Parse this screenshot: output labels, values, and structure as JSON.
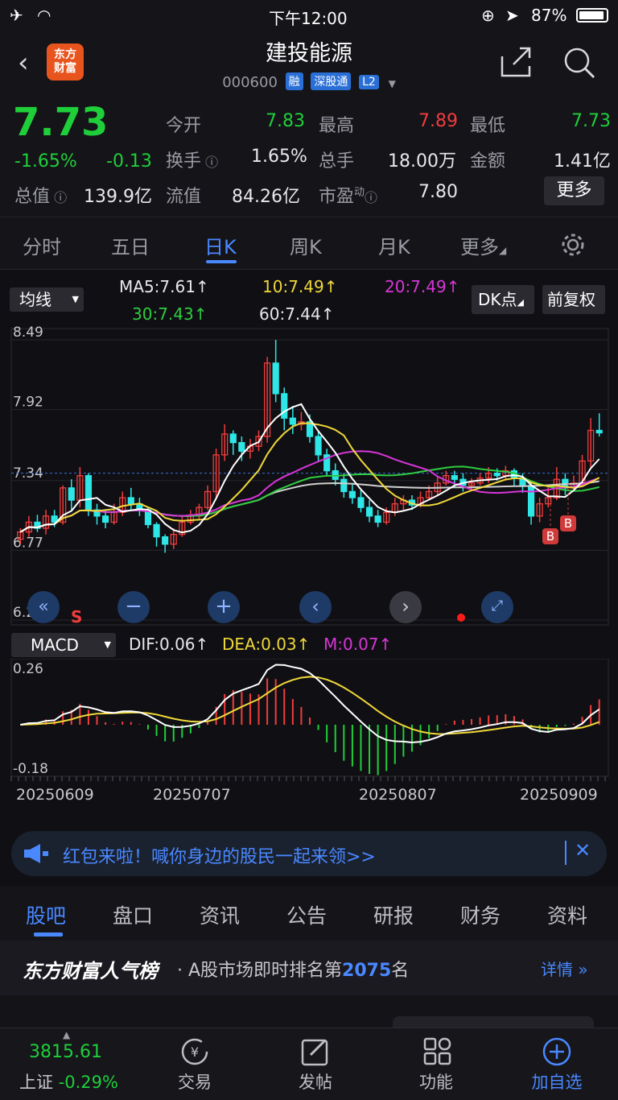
{
  "status": {
    "time": "下午12:00",
    "battery": "87%"
  },
  "nav": {
    "logo_line1": "东方",
    "logo_line2": "财富",
    "title": "建投能源",
    "code": "000600",
    "tags": [
      "融",
      "深股通",
      "L2"
    ]
  },
  "quote": {
    "price": "7.73",
    "change_pct": "-1.65%",
    "change": "-0.13",
    "total_value_label": "总值",
    "total_value": "139.9亿",
    "open_label": "今开",
    "open": "7.83",
    "high_label": "最高",
    "high": "7.89",
    "low_label": "最低",
    "low": "7.73",
    "turnover_label": "换手",
    "turnover": "1.65%",
    "volume_label": "总手",
    "volume": "18.00万",
    "amount_label": "金额",
    "amount": "1.41亿",
    "float_label": "流值",
    "float_value": "84.26亿",
    "pe_label": "市盈",
    "pe_sup": "动",
    "pe": "7.80",
    "more_label": "更多"
  },
  "tabs": [
    "分时",
    "五日",
    "日K",
    "周K",
    "月K",
    "更多"
  ],
  "active_tab": "日K",
  "chart": {
    "ma_dropdown": "均线",
    "ma5": "MA5:7.61",
    "ma10": "10:7.49",
    "ma20": "20:7.49",
    "ma30": "30:7.43",
    "ma60": "60:7.44",
    "dk_button": "DK点",
    "adjust_button": "前复权",
    "price_ticks": [
      "8.49",
      "7.92",
      "7.34",
      "6.77",
      "6.20"
    ],
    "macd_dropdown": "MACD",
    "dif": "DIF:0.06",
    "dea": "DEA:0.03",
    "m": "M:0.07",
    "macd_ticks": [
      "0.26",
      "-0.18"
    ],
    "dates": [
      "20250609",
      "20250707",
      "20250807",
      "20250909"
    ],
    "signal_s": "S",
    "signal_b": "B",
    "colors": {
      "up": "#f23c3c",
      "down": "#2ee6e6",
      "ma5": "#ffffff",
      "ma10": "#f0d83a",
      "ma20": "#d836d8",
      "ma30": "#2ecc40",
      "ma60": "#d0d0d0"
    }
  },
  "chart_data": {
    "type": "candlestick",
    "ylim": [
      6.2,
      8.49
    ],
    "candles": [
      [
        6.86,
        6.92,
        6.82,
        6.95
      ],
      [
        6.92,
        7.0,
        6.88,
        7.05
      ],
      [
        7.0,
        6.95,
        6.92,
        7.06
      ],
      [
        6.95,
        7.05,
        6.9,
        7.1
      ],
      [
        7.05,
        7.0,
        6.96,
        7.1
      ],
      [
        7.0,
        7.28,
        6.98,
        7.3
      ],
      [
        7.28,
        7.18,
        7.1,
        7.35
      ],
      [
        7.18,
        7.38,
        7.12,
        7.45
      ],
      [
        7.38,
        7.1,
        7.05,
        7.4
      ],
      [
        7.1,
        7.05,
        6.98,
        7.15
      ],
      [
        7.05,
        7.0,
        6.95,
        7.1
      ],
      [
        7.0,
        7.08,
        6.98,
        7.15
      ],
      [
        7.08,
        7.2,
        7.05,
        7.25
      ],
      [
        7.2,
        7.15,
        7.1,
        7.28
      ],
      [
        7.15,
        7.1,
        7.05,
        7.2
      ],
      [
        7.1,
        6.98,
        6.95,
        7.12
      ],
      [
        6.98,
        6.88,
        6.8,
        7.0
      ],
      [
        6.88,
        6.82,
        6.75,
        6.9
      ],
      [
        6.82,
        6.9,
        6.78,
        6.95
      ],
      [
        6.9,
        7.0,
        6.88,
        7.05
      ],
      [
        7.0,
        7.05,
        6.98,
        7.1
      ],
      [
        7.05,
        7.12,
        7.02,
        7.15
      ],
      [
        7.12,
        7.25,
        7.1,
        7.3
      ],
      [
        7.25,
        7.55,
        7.2,
        7.6
      ],
      [
        7.55,
        7.72,
        7.5,
        7.8
      ],
      [
        7.72,
        7.65,
        7.55,
        7.75
      ],
      [
        7.65,
        7.58,
        7.5,
        7.7
      ],
      [
        7.58,
        7.62,
        7.52,
        7.68
      ],
      [
        7.62,
        7.7,
        7.58,
        7.75
      ],
      [
        7.7,
        8.3,
        7.65,
        8.35
      ],
      [
        8.3,
        8.05,
        7.98,
        8.49
      ],
      [
        8.05,
        7.85,
        7.75,
        8.1
      ],
      [
        7.85,
        7.8,
        7.72,
        7.95
      ],
      [
        7.8,
        7.82,
        7.75,
        7.9
      ],
      [
        7.82,
        7.7,
        7.65,
        7.88
      ],
      [
        7.7,
        7.55,
        7.5,
        7.75
      ],
      [
        7.55,
        7.42,
        7.38,
        7.6
      ],
      [
        7.42,
        7.35,
        7.3,
        7.48
      ],
      [
        7.35,
        7.25,
        7.2,
        7.4
      ],
      [
        7.25,
        7.2,
        7.15,
        7.32
      ],
      [
        7.2,
        7.12,
        7.08,
        7.26
      ],
      [
        7.12,
        7.05,
        7.0,
        7.18
      ],
      [
        7.05,
        7.0,
        6.96,
        7.1
      ],
      [
        7.0,
        7.08,
        6.98,
        7.12
      ],
      [
        7.08,
        7.15,
        7.05,
        7.2
      ],
      [
        7.15,
        7.18,
        7.1,
        7.22
      ],
      [
        7.18,
        7.14,
        7.1,
        7.22
      ],
      [
        7.14,
        7.2,
        7.12,
        7.25
      ],
      [
        7.2,
        7.25,
        7.18,
        7.3
      ],
      [
        7.25,
        7.32,
        7.22,
        7.38
      ],
      [
        7.32,
        7.38,
        7.3,
        7.42
      ],
      [
        7.38,
        7.35,
        7.28,
        7.42
      ],
      [
        7.35,
        7.3,
        7.25,
        7.4
      ],
      [
        7.3,
        7.32,
        7.26,
        7.36
      ],
      [
        7.32,
        7.36,
        7.3,
        7.4
      ],
      [
        7.36,
        7.4,
        7.32,
        7.45
      ],
      [
        7.4,
        7.38,
        7.34,
        7.44
      ],
      [
        7.38,
        7.42,
        7.35,
        7.46
      ],
      [
        7.42,
        7.36,
        7.3,
        7.44
      ],
      [
        7.36,
        7.3,
        7.24,
        7.4
      ],
      [
        7.3,
        7.05,
        6.98,
        7.32
      ],
      [
        7.05,
        7.15,
        7.0,
        7.2
      ],
      [
        7.15,
        7.2,
        7.12,
        7.3
      ],
      [
        7.2,
        7.35,
        7.18,
        7.45
      ],
      [
        7.35,
        7.28,
        7.22,
        7.4
      ],
      [
        7.28,
        7.32,
        7.25,
        7.38
      ],
      [
        7.32,
        7.5,
        7.3,
        7.55
      ],
      [
        7.5,
        7.75,
        7.45,
        7.85
      ],
      [
        7.75,
        7.73,
        7.7,
        7.89
      ]
    ]
  },
  "banner": {
    "text": "红包来啦！喊你身边的股民一起来领>>"
  },
  "bottom_tabs": [
    "股吧",
    "盘口",
    "资讯",
    "公告",
    "研报",
    "财务",
    "资料"
  ],
  "active_bottom_tab": "股吧",
  "rank": {
    "brand": "东方财富人气榜",
    "prefix": "· A股市场即时排名第",
    "rank": "2075",
    "suffix": "名",
    "detail": "详情"
  },
  "bottom_bar": {
    "index_value": "3815.61",
    "index_name": "上证",
    "index_change": "-0.29%",
    "trade": "交易",
    "post": "发帖",
    "func": "功能",
    "add": "加自选"
  }
}
